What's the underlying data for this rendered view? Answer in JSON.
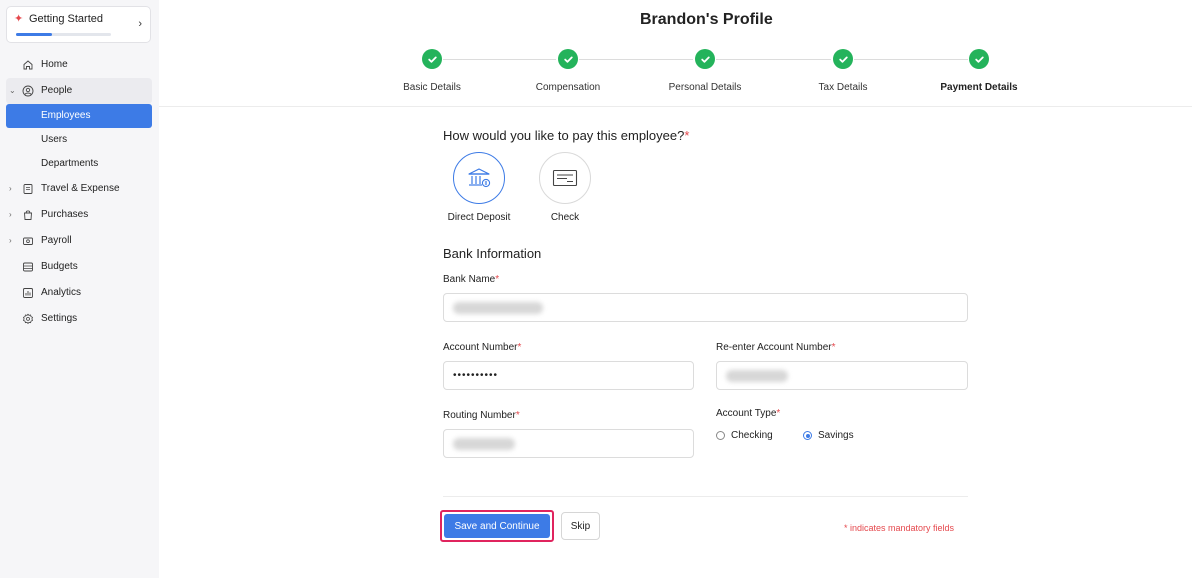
{
  "sidebar": {
    "getting_started": {
      "label": "Getting Started",
      "progress": 0.38
    },
    "items": [
      {
        "label": "Home",
        "icon": "home-icon"
      },
      {
        "label": "People",
        "icon": "user-circle-icon",
        "expanded": true
      },
      {
        "label": "Employees",
        "active": true
      },
      {
        "label": "Users"
      },
      {
        "label": "Departments"
      },
      {
        "label": "Travel & Expense",
        "icon": "receipt-icon"
      },
      {
        "label": "Purchases",
        "icon": "bag-icon"
      },
      {
        "label": "Payroll",
        "icon": "money-icon"
      },
      {
        "label": "Budgets",
        "icon": "budget-icon"
      },
      {
        "label": "Analytics",
        "icon": "chart-icon"
      },
      {
        "label": "Settings",
        "icon": "gear-icon"
      }
    ]
  },
  "header": {
    "title": "Brandon's Profile",
    "steps": [
      {
        "label": "Basic Details",
        "done": true
      },
      {
        "label": "Compensation",
        "done": true
      },
      {
        "label": "Personal Details",
        "done": true
      },
      {
        "label": "Tax Details",
        "done": true
      },
      {
        "label": "Payment Details",
        "done": true,
        "current": true
      }
    ]
  },
  "form": {
    "question": "How would you like to pay this employee?",
    "required_mark": "*",
    "pay_options": [
      {
        "label": "Direct Deposit",
        "selected": true,
        "icon": "bank-icon"
      },
      {
        "label": "Check",
        "selected": false,
        "icon": "check-icon"
      }
    ],
    "section_title": "Bank Information",
    "bank_name_label": "Bank Name",
    "account_number_label": "Account Number",
    "account_number_value": "••••••••••",
    "reenter_account_label": "Re-enter Account Number",
    "routing_number_label": "Routing Number",
    "account_type_label": "Account Type",
    "account_types": [
      {
        "label": "Checking",
        "checked": false
      },
      {
        "label": "Savings",
        "checked": true
      }
    ],
    "save_label": "Save and Continue",
    "skip_label": "Skip",
    "mandatory_note": "* indicates mandatory fields"
  },
  "colors": {
    "accent": "#3d7be6",
    "success": "#24b35b",
    "required": "#e5484d",
    "highlight": "#e0245e"
  }
}
